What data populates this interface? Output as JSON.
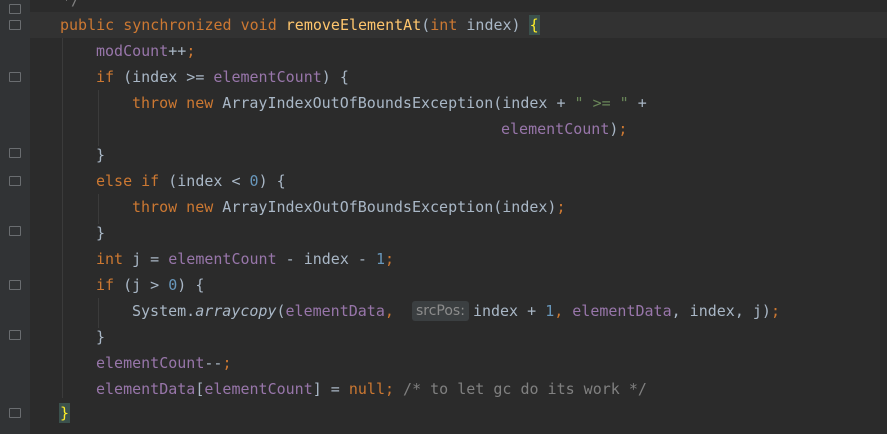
{
  "editor": {
    "lines": {
      "l0": "*/",
      "l1_kw": "public synchronized void",
      "l1_meth": "removeElementAt",
      "l1_paren_open": "(",
      "l1_int": "int",
      "l1_rest": " index) ",
      "l1_brace": "{",
      "l2_fld": "modCount",
      "l2_rest": "++",
      "l2_semi": ";",
      "l3_kw": "if",
      "l3_a": " (index >= ",
      "l3_fld": "elementCount",
      "l3_b": ") {",
      "l4_kw": "throw new",
      "l4_a": " ArrayIndexOutOfBoundsException(index + ",
      "l4_str": "\" >= \"",
      "l4_b": " +",
      "l5_fld": "elementCount",
      "l5_b": ")",
      "l5_semi": ";",
      "l6": "}",
      "l7_kw": "else if",
      "l7_a": " (index < ",
      "l7_num": "0",
      "l7_b": ") {",
      "l8_kw": "throw new",
      "l8_a": " ArrayIndexOutOfBoundsException(index)",
      "l8_semi": ";",
      "l9": "}",
      "l10_kw": "int",
      "l10_a": " j = ",
      "l10_fld": "elementCount",
      "l10_b": " - index - ",
      "l10_num": "1",
      "l10_semi": ";",
      "l11_kw": "if",
      "l11_a": " (j > ",
      "l11_num": "0",
      "l11_b": ") {",
      "l12_a": "System.",
      "l12_meth": "arraycopy",
      "l12_b": "(",
      "l12_fld1": "elementData",
      "l12_c": ",  ",
      "l12_hint": "srcPos:",
      "l12_d": "index + ",
      "l12_num": "1",
      "l12_e": ", ",
      "l12_fld2": "elementData",
      "l12_f": ", index, j)",
      "l12_semi": ";",
      "l13": "}",
      "l14_fld": "elementCount",
      "l14_rest": "--",
      "l14_semi": ";",
      "l15_fld1": "elementData",
      "l15_a": "[",
      "l15_fld2": "elementCount",
      "l15_b": "] = ",
      "l15_kw": "null",
      "l15_semi": ";",
      "l15_cmt": " /* to let gc do its work */",
      "l16": "}"
    }
  }
}
